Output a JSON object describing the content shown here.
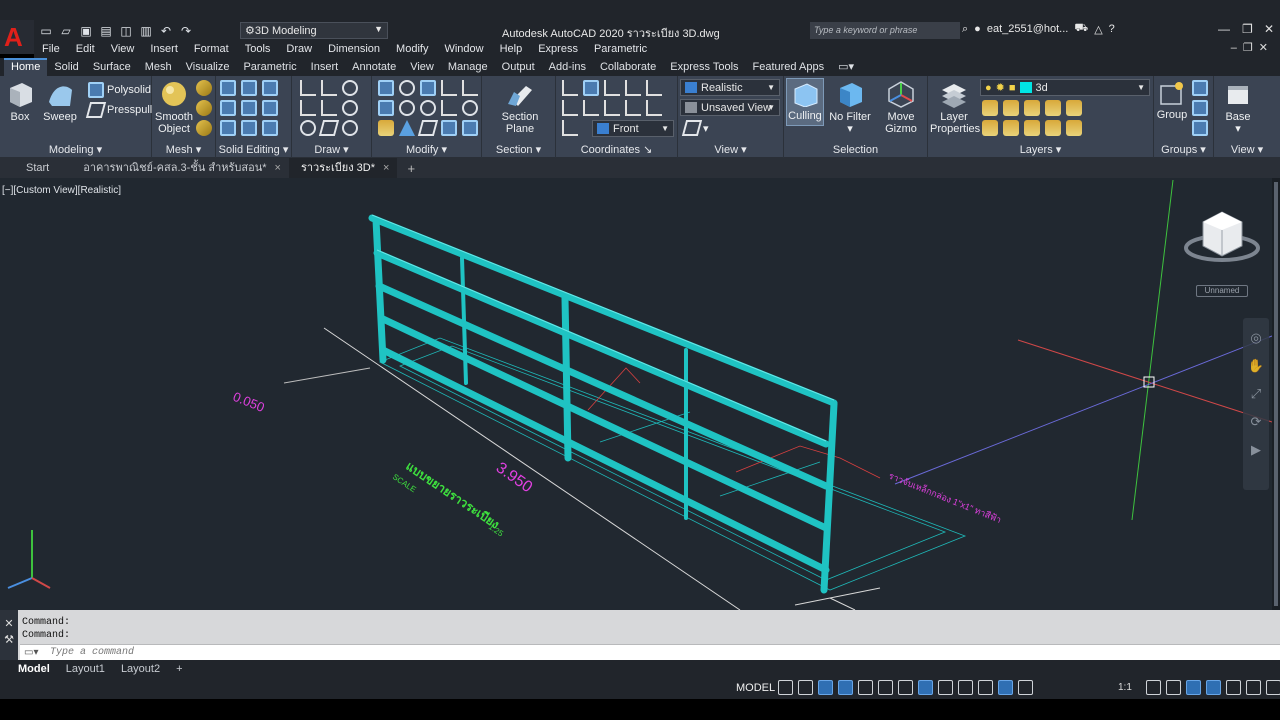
{
  "app": {
    "logo_letter": "A",
    "workspace": "3D Modeling",
    "window_title": "Autodesk AutoCAD 2020   ราวระเบียง 3D.dwg",
    "search_placeholder": "Type a keyword or phrase",
    "user": "eat_2551@hot...",
    "help": "?"
  },
  "menu": [
    "File",
    "Edit",
    "View",
    "Insert",
    "Format",
    "Tools",
    "Draw",
    "Dimension",
    "Modify",
    "Window",
    "Help",
    "Express",
    "Parametric"
  ],
  "ribbon_tabs": [
    "Home",
    "Solid",
    "Surface",
    "Mesh",
    "Visualize",
    "Parametric",
    "Insert",
    "Annotate",
    "View",
    "Manage",
    "Output",
    "Add-ins",
    "Collaborate",
    "Express Tools",
    "Featured Apps"
  ],
  "active_ribbon_tab": "Home",
  "panels": {
    "modeling": {
      "title": "Modeling",
      "box": "Box",
      "sweep": "Sweep",
      "polysolid": "Polysolid",
      "presspull": "Presspull"
    },
    "mesh": {
      "title": "Mesh",
      "smooth": "Smooth",
      "object": "Object"
    },
    "solid_editing": {
      "title": "Solid Editing"
    },
    "draw": {
      "title": "Draw"
    },
    "modify": {
      "title": "Modify"
    },
    "section": {
      "title": "Section",
      "label1": "Section",
      "label2": "Plane"
    },
    "coordinates": {
      "title": "Coordinates",
      "ucs": "Front"
    },
    "view": {
      "title": "View",
      "visual_style": "Realistic",
      "named_view": "Unsaved View"
    },
    "selection": {
      "title": "Selection",
      "culling": "Culling",
      "no_filter": "No Filter",
      "move": "Move",
      "gizmo": "Gizmo"
    },
    "layers": {
      "title": "Layers",
      "lp1": "Layer",
      "lp2": "Properties",
      "current_layer": "3d",
      "layer_color": "#00e5e5"
    },
    "groups": {
      "title": "Groups",
      "group": "Group"
    },
    "view2": {
      "title": "View",
      "base": "Base"
    }
  },
  "doc_tabs": [
    {
      "label": "Start",
      "active": false,
      "close": ""
    },
    {
      "label": "อาคารพาณิชย์-คสล.3-ชั้น สำหรับสอน*",
      "active": false,
      "close": "×"
    },
    {
      "label": "ราวระเบียง 3D*",
      "active": true,
      "close": "×"
    }
  ],
  "viewport": {
    "label": "[−][Custom View][Realistic]",
    "unnamed": "Unnamed",
    "dims": {
      "d1": "0.050",
      "d2": "3.950",
      "note_green": "แบบขยายราวระเบียง",
      "note_scale": "SCALE",
      "note_scale_val": "1:25",
      "note_pink": "ราวจับเหล็กกล่อง 1\"x1\" ทาสีฟ้า"
    },
    "rail_color": "#1fc3c3"
  },
  "command": {
    "history": [
      "Command:",
      "Command:"
    ],
    "placeholder": "Type a command"
  },
  "layout_tabs": [
    "Model",
    "Layout1",
    "Layout2"
  ],
  "status": {
    "model": "MODEL",
    "scale": "1:1"
  }
}
